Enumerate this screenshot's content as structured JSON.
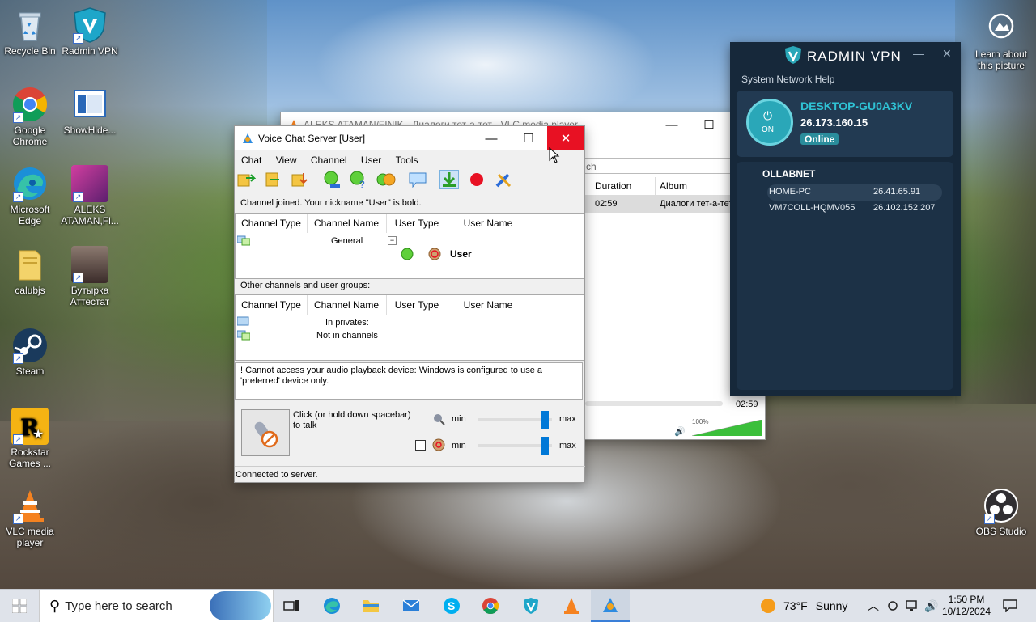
{
  "desktop": {
    "icons": [
      {
        "label": "Recycle Bin"
      },
      {
        "label": "Radmin VPN"
      },
      {
        "label": "Google Chrome"
      },
      {
        "label": "ShowHide..."
      },
      {
        "label": "Microsoft Edge"
      },
      {
        "label": "ALEKS ATAMAN,Fl..."
      },
      {
        "label": "calubjs"
      },
      {
        "label": "Бутырка Аттестат"
      },
      {
        "label": "Steam"
      },
      {
        "label": "Rockstar Games ..."
      },
      {
        "label": "VLC media player"
      },
      {
        "label": "OBS Studio"
      },
      {
        "label": "Learn about this picture"
      }
    ]
  },
  "vlc": {
    "title": "ALEKS ATAMAN/FINIK - Диалоги тет-а-тет - VLC media player",
    "search_fragment": "ch",
    "columns": [
      "Duration",
      "Album"
    ],
    "row": {
      "duration": "02:59",
      "album": "Диалоги тет-а-тет"
    },
    "time_total": "02:59",
    "volume": "100%",
    "volume_level": 1.0
  },
  "voice": {
    "title": "Voice Chat Server [User]",
    "menu": [
      "Chat",
      "View",
      "Channel",
      "User",
      "Tools"
    ],
    "status_joined": "Channel joined. Your nickname \"User\" is bold.",
    "columns": [
      "Channel Type",
      "Channel Name",
      "User Type",
      "User Name"
    ],
    "channel_name": "General",
    "user_name": "User",
    "other_label": "Other channels and user groups:",
    "in_privates": "In privates:",
    "not_in_channels": "Not in channels",
    "error_msg": "! Cannot access your audio playback device: Windows is configured to use a 'preferred' device only.",
    "talk_hint": "Click (or  hold down spacebar) to talk",
    "min_label": "min",
    "max_label": "max",
    "slider1_level": 0.95,
    "slider2_level": 0.95,
    "statusbar": "Connected to server."
  },
  "radmin": {
    "brand": "RADMIN VPN",
    "menu": [
      "System",
      "Network",
      "Help"
    ],
    "power_label": "ON",
    "hostname": "DESKTOP-GU0A3KV",
    "ip": "26.173.160.15",
    "status": "Online",
    "network_name": "OLLABNET",
    "peers": [
      {
        "name": "HOME-PC",
        "ip": "26.41.65.91"
      },
      {
        "name": "VM7COLL-HQMV055",
        "ip": "26.102.152.207"
      }
    ]
  },
  "taskbar": {
    "search_placeholder": "Type here to search",
    "weather_temp": "73°F",
    "weather_desc": "Sunny",
    "time": "1:50 PM",
    "date": "10/12/2024"
  },
  "colors": {
    "close_red": "#e81123",
    "radmin_bg": "#16283a",
    "radmin_accent": "#2aa7b8",
    "taskbar_bg": "#dfe3ea"
  }
}
